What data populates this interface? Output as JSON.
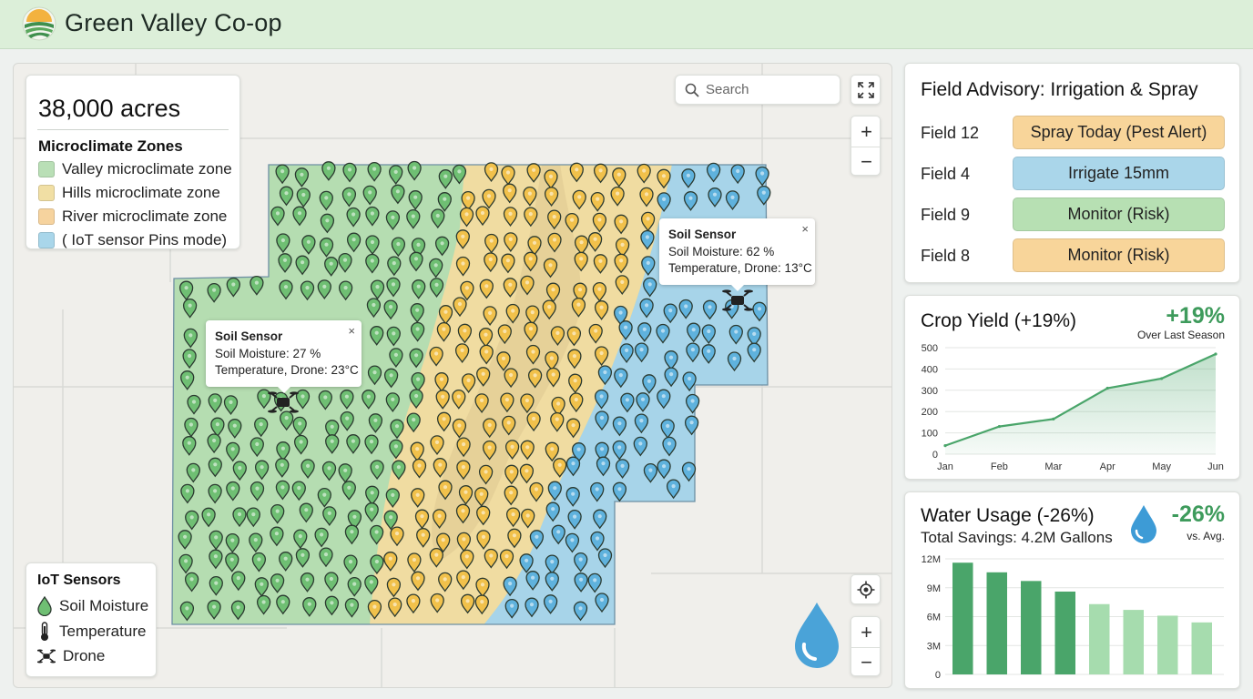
{
  "app": {
    "title": "Green Valley Co-op",
    "logo_icon": "farm-sunrise-logo"
  },
  "map": {
    "acres": "38,000 acres",
    "zones_title": "Microclimate Zones",
    "zones": [
      {
        "label": "Valley microclimate zone",
        "color": "#b9dfb6"
      },
      {
        "label": "Hills microclimate zone",
        "color": "#f1dfa4"
      },
      {
        "label": "River microclimate zone",
        "color": "#f6d39e"
      },
      {
        "label": "( IoT sensor Pins mode)",
        "color": "#a9d6ea"
      }
    ],
    "search_placeholder": "Search",
    "sensors_title": "IoT Sensors",
    "sensors": [
      {
        "label": "Soil Moisture",
        "icon": "soil-moisture-drop-icon"
      },
      {
        "label": "Temperature",
        "icon": "thermometer-icon"
      },
      {
        "label": "Drone",
        "icon": "drone-icon"
      }
    ],
    "popups": [
      {
        "title": "Soil Sensor",
        "line1": "Soil Moisture: 62 %",
        "line2": "Temperature, Drone: 13°C"
      },
      {
        "title": "Soil Sensor",
        "line1": "Soil Moisture: 27 %",
        "line2": "Temperature, Drone: 23°C"
      }
    ],
    "close_symbol": "×",
    "zoom_in": "+",
    "zoom_out": "−"
  },
  "advisory": {
    "title": "Field Advisory: Irrigation & Spray",
    "rows": [
      {
        "field": "Field 12",
        "action": "Spray Today (Pest Alert)",
        "color": "#f8d59a"
      },
      {
        "field": "Field 4",
        "action": "Irrigate 15mm",
        "color": "#aad6ea"
      },
      {
        "field": "Field 9",
        "action": "Monitor (Risk)",
        "color": "#b7e0b3"
      },
      {
        "field": "Field 8",
        "action": "Monitor (Risk)",
        "color": "#f8d59a"
      }
    ]
  },
  "yield": {
    "title": "Crop Yield (+19%)",
    "pct": "+19%",
    "sub": "Over Last Season",
    "chart_data": {
      "type": "area",
      "categories": [
        "Jan",
        "Feb",
        "Mar",
        "Apr",
        "May",
        "Jun"
      ],
      "values": [
        40,
        130,
        165,
        310,
        355,
        470
      ],
      "ylim": [
        0,
        500
      ],
      "yticks": [
        "0",
        "100",
        "200",
        "300",
        "400",
        "500"
      ],
      "grid": true,
      "color": "#4aa56a"
    }
  },
  "water": {
    "title": "Water Usage (-26%)",
    "sub": "Total Savings: 4.2M Gallons",
    "pct": "-26%",
    "vs": "vs. Avg.",
    "drop_icon": "water-drop-icon",
    "chart_data": {
      "type": "bar",
      "values": [
        11.6,
        10.6,
        9.7,
        8.6,
        7.3,
        6.7,
        6.1,
        5.4
      ],
      "colors": [
        "#4aa56a",
        "#4aa56a",
        "#4aa56a",
        "#4aa56a",
        "#a6dcae",
        "#a6dcae",
        "#a6dcae",
        "#a6dcae"
      ],
      "ylim": [
        0,
        12
      ],
      "yticks": [
        "0",
        "3M",
        "6M",
        "9M",
        "12M"
      ],
      "grid": true
    }
  }
}
